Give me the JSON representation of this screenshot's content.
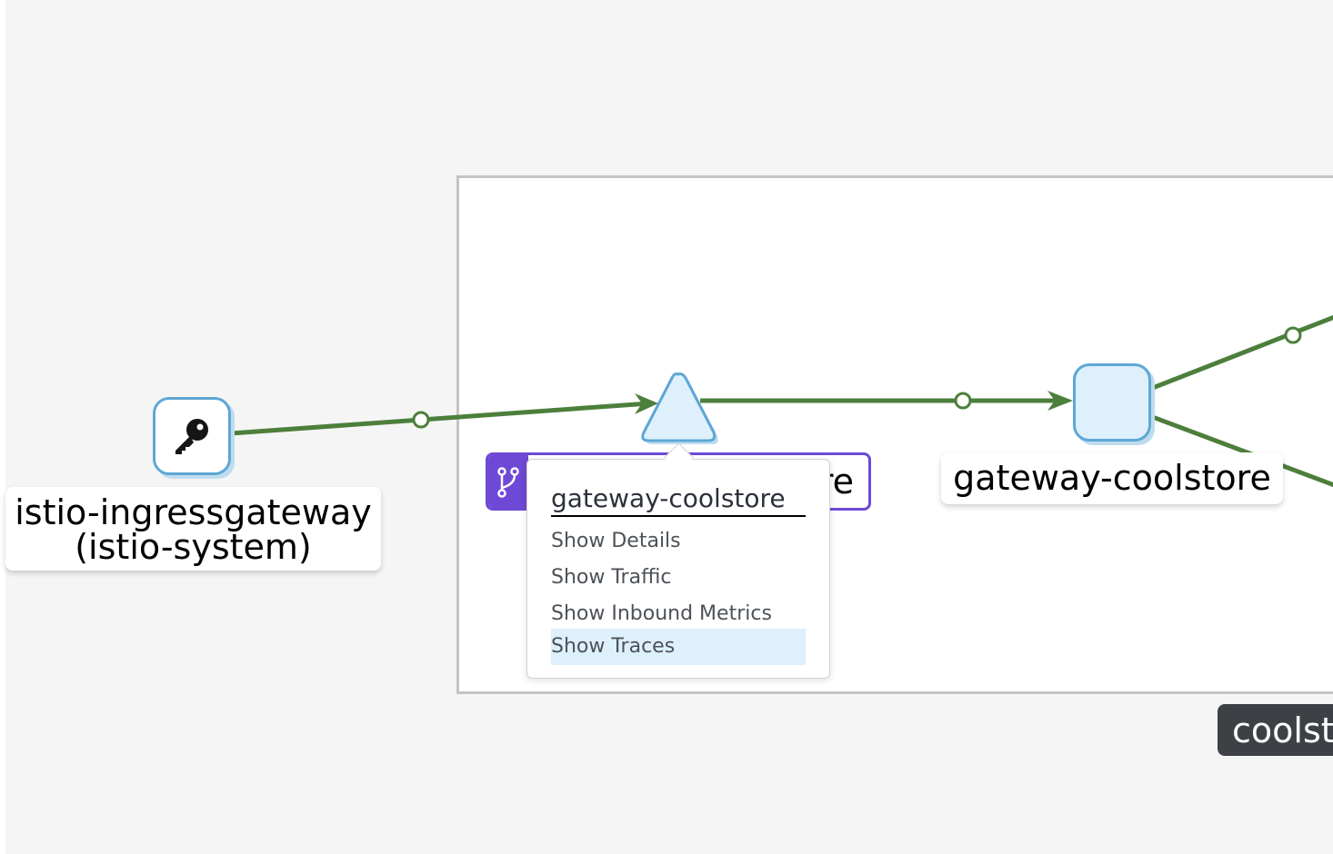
{
  "graph": {
    "ingress_node": {
      "label_line1": "istio-ingressgateway",
      "label_line2": "(istio-system)",
      "icon": "key-icon"
    },
    "app_node": {
      "label_partial": "re",
      "icon": "code-branch-icon"
    },
    "service_node": {
      "label": "gateway-coolstore"
    },
    "namespace_box": {
      "label_partial": "coolst"
    },
    "edge_color": "#4d7f3c",
    "node_color": "#def0fb",
    "node_border": "#5ea7d4",
    "app_label_color": "#6e49d6"
  },
  "context_menu": {
    "title": "gateway-coolstore",
    "items": [
      "Show Details",
      "Show Traffic",
      "Show Inbound Metrics",
      "Show Traces"
    ],
    "highlighted_item": "Show Traces"
  }
}
